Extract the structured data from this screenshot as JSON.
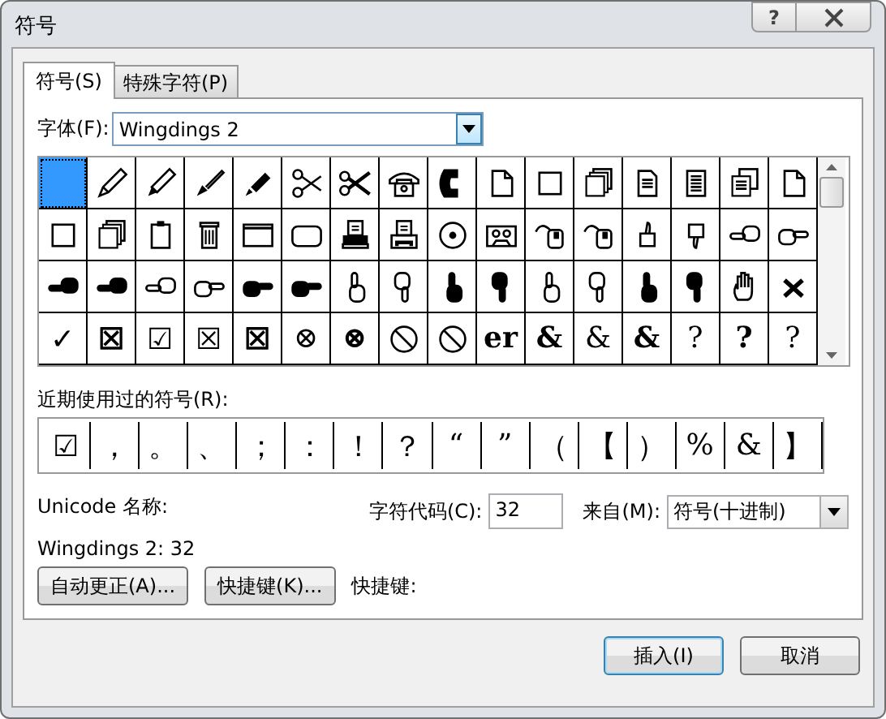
{
  "window": {
    "title": "符号",
    "help_button": "?"
  },
  "tabs": [
    {
      "label": "符号(S)",
      "selected": true
    },
    {
      "label": "特殊字符(P)",
      "selected": false
    }
  ],
  "font": {
    "label": "字体(F):",
    "value": "Wingdings 2"
  },
  "symbols": {
    "cells": [
      {
        "kind": "blank",
        "selected": true
      },
      {
        "kind": "pencil",
        "selected": false
      },
      {
        "kind": "pen",
        "selected": false
      },
      {
        "kind": "brush",
        "selected": false
      },
      {
        "kind": "marker",
        "selected": false
      },
      {
        "kind": "scissors-open",
        "selected": false
      },
      {
        "kind": "scissors",
        "selected": false
      },
      {
        "kind": "phone",
        "selected": false
      },
      {
        "kind": "handset",
        "selected": false
      },
      {
        "kind": "page",
        "selected": false
      },
      {
        "kind": "square",
        "selected": false
      },
      {
        "kind": "stack",
        "selected": false
      },
      {
        "kind": "doc",
        "selected": false
      },
      {
        "kind": "doc-lines",
        "selected": false
      },
      {
        "kind": "doc-stack",
        "selected": false
      },
      {
        "kind": "page",
        "selected": false
      },
      {
        "kind": "square",
        "selected": false
      },
      {
        "kind": "stack",
        "selected": false
      },
      {
        "kind": "clipboard",
        "selected": false
      },
      {
        "kind": "trash",
        "selected": false
      },
      {
        "kind": "window",
        "selected": false
      },
      {
        "kind": "rounded-rect",
        "selected": false
      },
      {
        "kind": "printer",
        "selected": false
      },
      {
        "kind": "fax",
        "selected": false
      },
      {
        "kind": "disc",
        "selected": false
      },
      {
        "kind": "cassette",
        "selected": false
      },
      {
        "kind": "mouse",
        "selected": false
      },
      {
        "kind": "mouse",
        "selected": false
      },
      {
        "kind": "thumbs-up",
        "selected": false
      },
      {
        "kind": "thumbs-down",
        "selected": false
      },
      {
        "kind": "hand-left-outline",
        "selected": false
      },
      {
        "kind": "hand-right-outline",
        "selected": false
      },
      {
        "kind": "hand-left-solid",
        "selected": false
      },
      {
        "kind": "hand-left-solid",
        "selected": false
      },
      {
        "kind": "hand-left-outline",
        "selected": false
      },
      {
        "kind": "hand-right-outline",
        "selected": false
      },
      {
        "kind": "hand-right-solid",
        "selected": false
      },
      {
        "kind": "hand-right-solid",
        "selected": false
      },
      {
        "kind": "hand-up-outline",
        "selected": false
      },
      {
        "kind": "hand-down-outline",
        "selected": false
      },
      {
        "kind": "hand-up-solid",
        "selected": false
      },
      {
        "kind": "hand-down-solid",
        "selected": false
      },
      {
        "kind": "hand-up-outline",
        "selected": false
      },
      {
        "kind": "hand-down-outline",
        "selected": false
      },
      {
        "kind": "hand-up-solid",
        "selected": false
      },
      {
        "kind": "hand-down-solid",
        "selected": false
      },
      {
        "kind": "palm",
        "selected": false
      },
      {
        "kind": "cross",
        "selected": false
      },
      {
        "kind": "text",
        "glyph": "✓",
        "bold": false,
        "selected": false
      },
      {
        "kind": "text",
        "glyph": "☒",
        "bold": true,
        "selected": false
      },
      {
        "kind": "text",
        "glyph": "☑",
        "bold": false,
        "selected": false
      },
      {
        "kind": "text",
        "glyph": "☒",
        "bold": false,
        "selected": false
      },
      {
        "kind": "text",
        "glyph": "☒",
        "bold": true,
        "selected": false
      },
      {
        "kind": "text",
        "glyph": "⊗",
        "bold": false,
        "selected": false
      },
      {
        "kind": "text",
        "glyph": "⊗",
        "bold": true,
        "selected": false
      },
      {
        "kind": "prohibited",
        "selected": false
      },
      {
        "kind": "prohibited",
        "selected": false
      },
      {
        "kind": "text",
        "glyph": "er",
        "bold": true,
        "selected": false
      },
      {
        "kind": "text",
        "glyph": "&",
        "bold": true,
        "selected": false
      },
      {
        "kind": "text",
        "glyph": "&",
        "bold": false,
        "selected": false
      },
      {
        "kind": "text",
        "glyph": "&",
        "bold": true,
        "selected": false
      },
      {
        "kind": "text",
        "glyph": "?",
        "bold": false,
        "selected": false
      },
      {
        "kind": "text",
        "glyph": "?",
        "bold": true,
        "selected": false
      },
      {
        "kind": "text",
        "glyph": "?",
        "bold": false,
        "selected": false
      }
    ]
  },
  "recent": {
    "label": "近期使用过的符号(R):",
    "symbols": [
      "☑",
      "，",
      "。",
      "、",
      "；",
      "：",
      "！",
      "？",
      "“",
      "”",
      "（",
      "【",
      "）",
      "%",
      "&",
      "】"
    ]
  },
  "unicode_name": {
    "label": "Unicode 名称:",
    "value": "Wingdings 2: 32"
  },
  "char_code": {
    "label": "字符代码(C):",
    "value": "32"
  },
  "from": {
    "label": "来自(M):",
    "value": "符号(十进制)"
  },
  "autocorrect_button": "自动更正(A)...",
  "shortcut_button": "快捷键(K)...",
  "shortcut_label": "快捷键:",
  "insert_button": "插入(I)",
  "cancel_button": "取消"
}
